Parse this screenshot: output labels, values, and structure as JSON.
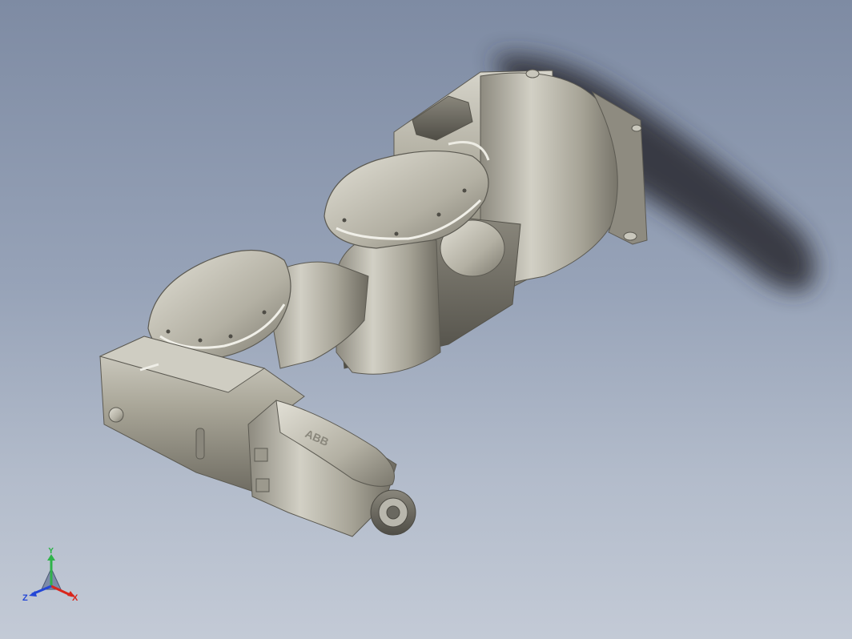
{
  "viewport": {
    "background_top": "#7e8ba3",
    "background_bottom": "#c3cad6"
  },
  "model": {
    "body_color": "#a4a196",
    "shadow_color": "#2a2c33",
    "logo_text": "ABB"
  },
  "triad": {
    "x_label": "X",
    "y_label": "Y",
    "z_label": "Z",
    "x_color": "#d9261c",
    "y_color": "#2fb34a",
    "z_color": "#2346d6"
  }
}
